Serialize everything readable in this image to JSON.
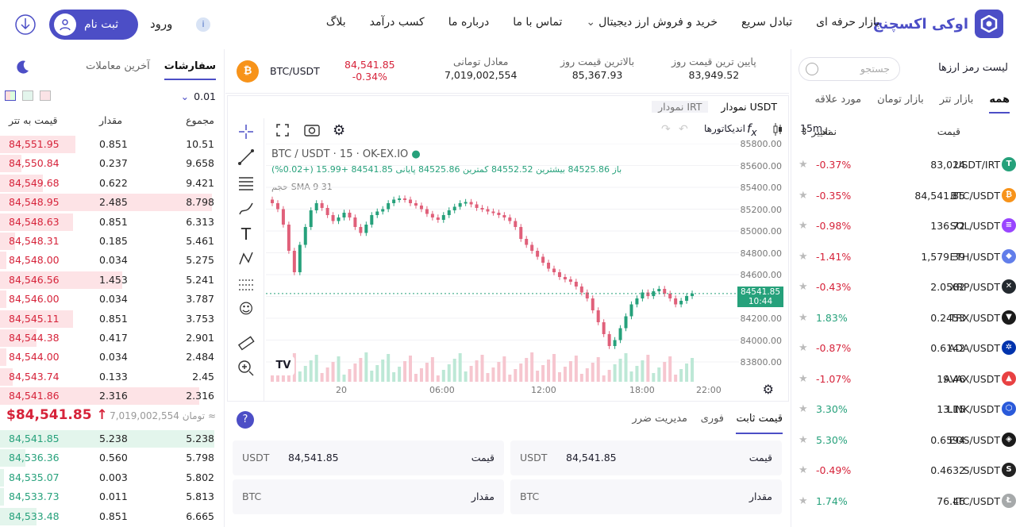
{
  "brand": {
    "name": "اوکی اکسچنج",
    "color": "#4c4ec6"
  },
  "nav": {
    "items": [
      "بازار حرفه ای",
      "تبادل سریع",
      "خرید و فروش ارز دیجیتال",
      "تماس با ما",
      "درباره ما",
      "کسب درآمد",
      "بلاگ"
    ],
    "login": "ورود",
    "register": "ثبت نام"
  },
  "orderbook": {
    "tabs": {
      "orders": "سفارشات",
      "trades": "آخرین معاملات"
    },
    "precision": "0.01",
    "headers": {
      "price": "قیمت به تتر",
      "amount": "مقدار",
      "total": "مجموع"
    },
    "asks": [
      [
        "84,551.95",
        "0.851",
        "10.51",
        0.35
      ],
      [
        "84,550.84",
        "0.237",
        "9.658",
        0.1
      ],
      [
        "84,549.68",
        "0.622",
        "9.421",
        0.2
      ],
      [
        "84,548.95",
        "2.485",
        "8.798",
        0.99
      ],
      [
        "84,548.63",
        "0.851",
        "6.313",
        0.34
      ],
      [
        "84,548.31",
        "0.185",
        "5.461",
        0.07
      ],
      [
        "84,548.00",
        "0.034",
        "5.275",
        0.03
      ],
      [
        "84,546.56",
        "1.453",
        "5.241",
        0.57
      ],
      [
        "84,546.00",
        "0.034",
        "3.787",
        0.03
      ],
      [
        "84,545.11",
        "0.851",
        "3.753",
        0.34
      ],
      [
        "84,544.38",
        "0.417",
        "2.901",
        0.17
      ],
      [
        "84,544.00",
        "0.034",
        "2.484",
        0.03
      ],
      [
        "84,543.74",
        "0.133",
        "2.45",
        0.06
      ],
      [
        "84,541.86",
        "2.316",
        "2.316",
        0.93
      ]
    ],
    "last_price": "$84,541.85 ↑",
    "last_toman": "7,019,002,554 تومان ≈",
    "bids": [
      [
        "84,541.85",
        "5.238",
        "5.238",
        1.0
      ],
      [
        "84,536.36",
        "0.560",
        "5.798",
        0.12
      ],
      [
        "84,535.07",
        "0.003",
        "5.802",
        0.02
      ],
      [
        "84,533.73",
        "0.011",
        "5.813",
        0.02
      ],
      [
        "84,533.48",
        "0.851",
        "6.665",
        0.17
      ]
    ]
  },
  "ticker": {
    "pair": "BTC/USDT",
    "price": "84,541.85",
    "change": "-0.34%",
    "toman_label": "معادل تومانی",
    "toman_value": "7,019,002,554",
    "high_label": "بالاترین قیمت روز",
    "high_value": "85,367.93",
    "low_label": "پایین ترین قیمت روز",
    "low_value": "83,949.52"
  },
  "chart": {
    "tabs": {
      "usdt": "نمودار USDT",
      "irt": "نمودار IRT"
    },
    "interval": "15m",
    "indicators": "اندیکاتورها",
    "legend": "BTC / USDT · 15 · OK-EX.IO",
    "ohlc": "باز 84525.86 بیشترین 84552.52 کمترین 84525.86 پایانی 84541.85 +15.99 (+0.02%)",
    "sma": "حجم SMA 9  31",
    "y_ticks": [
      "85800.00",
      "85600.00",
      "85400.00",
      "85200.00",
      "85000.00",
      "84800.00",
      "84600.00",
      "84400.00",
      "84200.00",
      "84000.00",
      "83800.00"
    ],
    "x_ticks": [
      "20",
      "06:00",
      "12:00",
      "18:00",
      "22:00"
    ],
    "price_tag": "84541.85",
    "time_tag": "10:44"
  },
  "chart_data": {
    "type": "candlestick",
    "ylim": [
      83800,
      85800
    ],
    "up_color": "#26a17b",
    "down_color": "#e0607a",
    "closes": [
      85300,
      85250,
      85120,
      84900,
      84720,
      84950,
      85100,
      85240,
      85300,
      85260,
      85200,
      85150,
      85180,
      85220,
      85180,
      85100,
      85050,
      85120,
      85200,
      85230,
      85250,
      85300,
      85330,
      85340,
      85330,
      85300,
      85280,
      85250,
      85210,
      85180,
      85160,
      85200,
      85240,
      85270,
      85300,
      85310,
      85290,
      85260,
      85250,
      85230,
      85220,
      85200,
      85180,
      85150,
      85100,
      85000,
      84950,
      84900,
      84850,
      84800,
      84750,
      84720,
      84680,
      84660,
      84640,
      84600,
      84550,
      84500,
      84400,
      84300,
      84200,
      84100,
      84150,
      84250,
      84350,
      84450,
      84500,
      84550,
      84520,
      84560,
      84580,
      84540,
      84500,
      84450,
      84480,
      84520,
      84541
    ]
  },
  "order_form": {
    "tabs": {
      "limit": "قیمت ثابت",
      "market": "فوری",
      "stop": "مدیریت ضرر"
    },
    "price_label": "قیمت",
    "amount_label": "مقدار",
    "price_value": "84,541.85",
    "quote": "USDT",
    "base": "BTC"
  },
  "markets": {
    "title": "لیست رمز ارزها",
    "search_placeholder": "جستجو",
    "tabs": [
      "همه",
      "بازار تتر",
      "بازار تومان",
      "مورد علاقه"
    ],
    "headers": {
      "change": "تغییر",
      "price": "قیمت",
      "symbol": "نماد"
    },
    "rows": [
      {
        "sym": "USDT/IRT",
        "price": "83,024",
        "chg": "-0.37%",
        "color": "#26a17b",
        "glyph": "T"
      },
      {
        "sym": "BTC/USDT",
        "price": "84,541.85",
        "chg": "-0.35%",
        "color": "#f7931a",
        "glyph": "₿"
      },
      {
        "sym": "SOL/USDT",
        "price": "136.72",
        "chg": "-0.98%",
        "color": "#9945ff",
        "glyph": "≡"
      },
      {
        "sym": "ETH/USDT",
        "price": "1,579.39",
        "chg": "-1.41%",
        "color": "#627eea",
        "glyph": "◆"
      },
      {
        "sym": "XRP/USDT",
        "price": "2.0582",
        "chg": "-0.43%",
        "color": "#23292f",
        "glyph": "✕"
      },
      {
        "sym": "TRX/USDT",
        "price": "0.2453",
        "chg": "1.83%",
        "color": "#1b1b1b",
        "glyph": "▼"
      },
      {
        "sym": "ADA/USDT",
        "price": "0.6142",
        "chg": "-0.87%",
        "color": "#0033ad",
        "glyph": "✲"
      },
      {
        "sym": "AVAX/USDT",
        "price": "19.46",
        "chg": "-1.07%",
        "color": "#e84142",
        "glyph": "▲"
      },
      {
        "sym": "LINK/USDT",
        "price": "13.15",
        "chg": "3.30%",
        "color": "#2a5ada",
        "glyph": "⬡"
      },
      {
        "sym": "EOS/USDT",
        "price": "0.6594",
        "chg": "5.30%",
        "color": "#1a1a1a",
        "glyph": "◈"
      },
      {
        "sym": "S/USDT",
        "price": "0.4632",
        "chg": "-0.49%",
        "color": "#222",
        "glyph": "S"
      },
      {
        "sym": "LTC/USDT",
        "price": "76.46",
        "chg": "1.74%",
        "color": "#a6a9aa",
        "glyph": "Ł"
      }
    ]
  }
}
